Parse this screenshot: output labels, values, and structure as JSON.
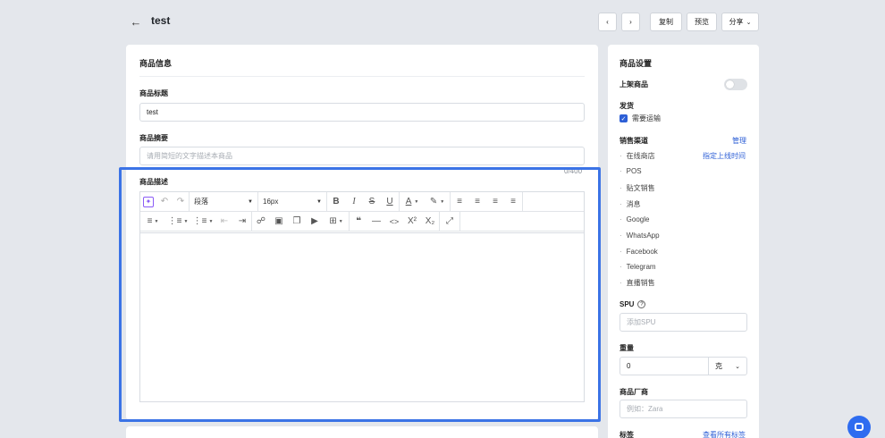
{
  "header": {
    "title": "test",
    "copy_label": "复制",
    "preview_label": "预览",
    "share_label": "分享"
  },
  "product_info": {
    "section_title": "商品信息",
    "title_label": "商品标题",
    "title_value": "test",
    "summary_label": "商品摘要",
    "summary_placeholder": "请用简短的文字描述本商品",
    "summary_counter": "0/400",
    "description_label": "商品描述"
  },
  "editor": {
    "paragraph_select": "段落",
    "font_size_select": "16px"
  },
  "settings": {
    "section_title": "商品设置",
    "publish_label": "上架商品",
    "shipping_label": "发货",
    "shipping_checkbox": "需要运输",
    "channels_label": "销售渠道",
    "channels_manage": "管理",
    "channels_schedule": "指定上线时间",
    "channels": [
      "在线商店",
      "POS",
      "贴文销售",
      "消息",
      "Google",
      "WhatsApp",
      "Facebook",
      "Telegram",
      "直播销售"
    ],
    "spu_label": "SPU",
    "spu_placeholder": "添加SPU",
    "weight_label": "重量",
    "weight_value": "0",
    "weight_unit": "克",
    "vendor_label": "商品厂商",
    "vendor_placeholder": "例如：Zara",
    "tags_label": "标签",
    "tags_link": "查看所有标签"
  },
  "colors": {
    "accent": "#2d5fd6",
    "highlight": "#3b73e6",
    "background": "#e4e7ec"
  }
}
